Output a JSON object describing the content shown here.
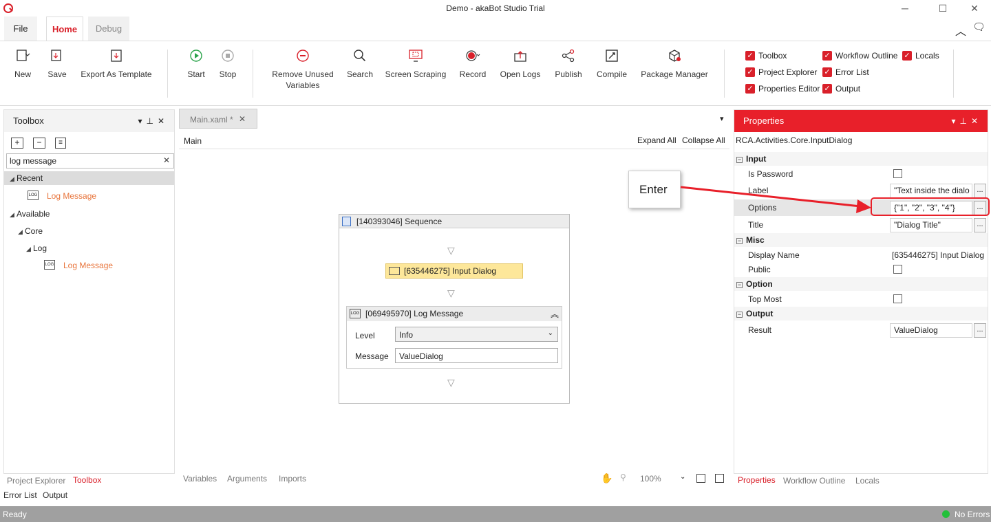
{
  "window": {
    "title": "Demo - akaBot Studio Trial"
  },
  "menu_tabs": [
    "File",
    "Home",
    "Debug"
  ],
  "ribbon": {
    "buttons": {
      "new": "New",
      "save": "Save",
      "export": "Export As Template",
      "start": "Start",
      "stop": "Stop",
      "remove_unused_1": "Remove Unused",
      "remove_unused_2": "Variables",
      "search": "Search",
      "screen_scraping": "Screen Scraping",
      "record": "Record",
      "open_logs": "Open Logs",
      "publish": "Publish",
      "compile": "Compile",
      "package_manager": "Package Manager"
    },
    "checkboxes": {
      "toolbox": "Toolbox",
      "workflow_outline": "Workflow Outline",
      "locals": "Locals",
      "project_explorer": "Project Explorer",
      "error_list": "Error List",
      "properties_editor": "Properties Editor",
      "output": "Output"
    }
  },
  "toolbox": {
    "title": "Toolbox",
    "search_value": "log message",
    "recent": "Recent",
    "recent_item": "Log Message",
    "available": "Available",
    "core": "Core",
    "log": "Log",
    "log_item": "Log Message"
  },
  "canvas": {
    "tab": "Main.xaml *",
    "breadcrumb": "Main",
    "expand_all": "Expand All",
    "collapse_all": "Collapse All",
    "sequence_title": "[140393046] Sequence",
    "input_dialog": "[635446275] Input Dialog",
    "log_message_title": "[069495970] Log Message",
    "level_label": "Level",
    "level_value": "Info",
    "message_label": "Message",
    "message_value": "ValueDialog",
    "bottom_tabs": [
      "Variables",
      "Arguments",
      "Imports"
    ],
    "zoom": "100%"
  },
  "annotation": {
    "text": "Enter",
    "color": "#e8202a"
  },
  "properties": {
    "title": "Properties",
    "type": "RCA.Activities.Core.InputDialog",
    "sections": {
      "input": "Input",
      "misc": "Misc",
      "option": "Option",
      "output": "Output"
    },
    "rows": {
      "is_password": "Is Password",
      "label": "Label",
      "label_value": "\"Text inside the dialo",
      "options": "Options",
      "options_value": "{\"1\", \"2\", \"3\", \"4\"}",
      "title": "Title",
      "title_value": "\"Dialog Title\"",
      "display_name": "Display Name",
      "display_name_value": "[635446275] Input Dialog",
      "public": "Public",
      "top_most": "Top Most",
      "result": "Result",
      "result_value": "ValueDialog"
    },
    "bottom_tabs": [
      "Properties",
      "Workflow Outline",
      "Locals"
    ]
  },
  "left_bottom_tabs": [
    "Project Explorer",
    "Toolbox"
  ],
  "bottom_tabs2": [
    "Error List",
    "Output"
  ],
  "status": {
    "left": "Ready",
    "right": "No Errors"
  },
  "colors": {
    "accent": "#d9202a",
    "panel_header": "#e8202a",
    "status_bar": "#a0a0a0",
    "highlight": "#fde79a"
  }
}
